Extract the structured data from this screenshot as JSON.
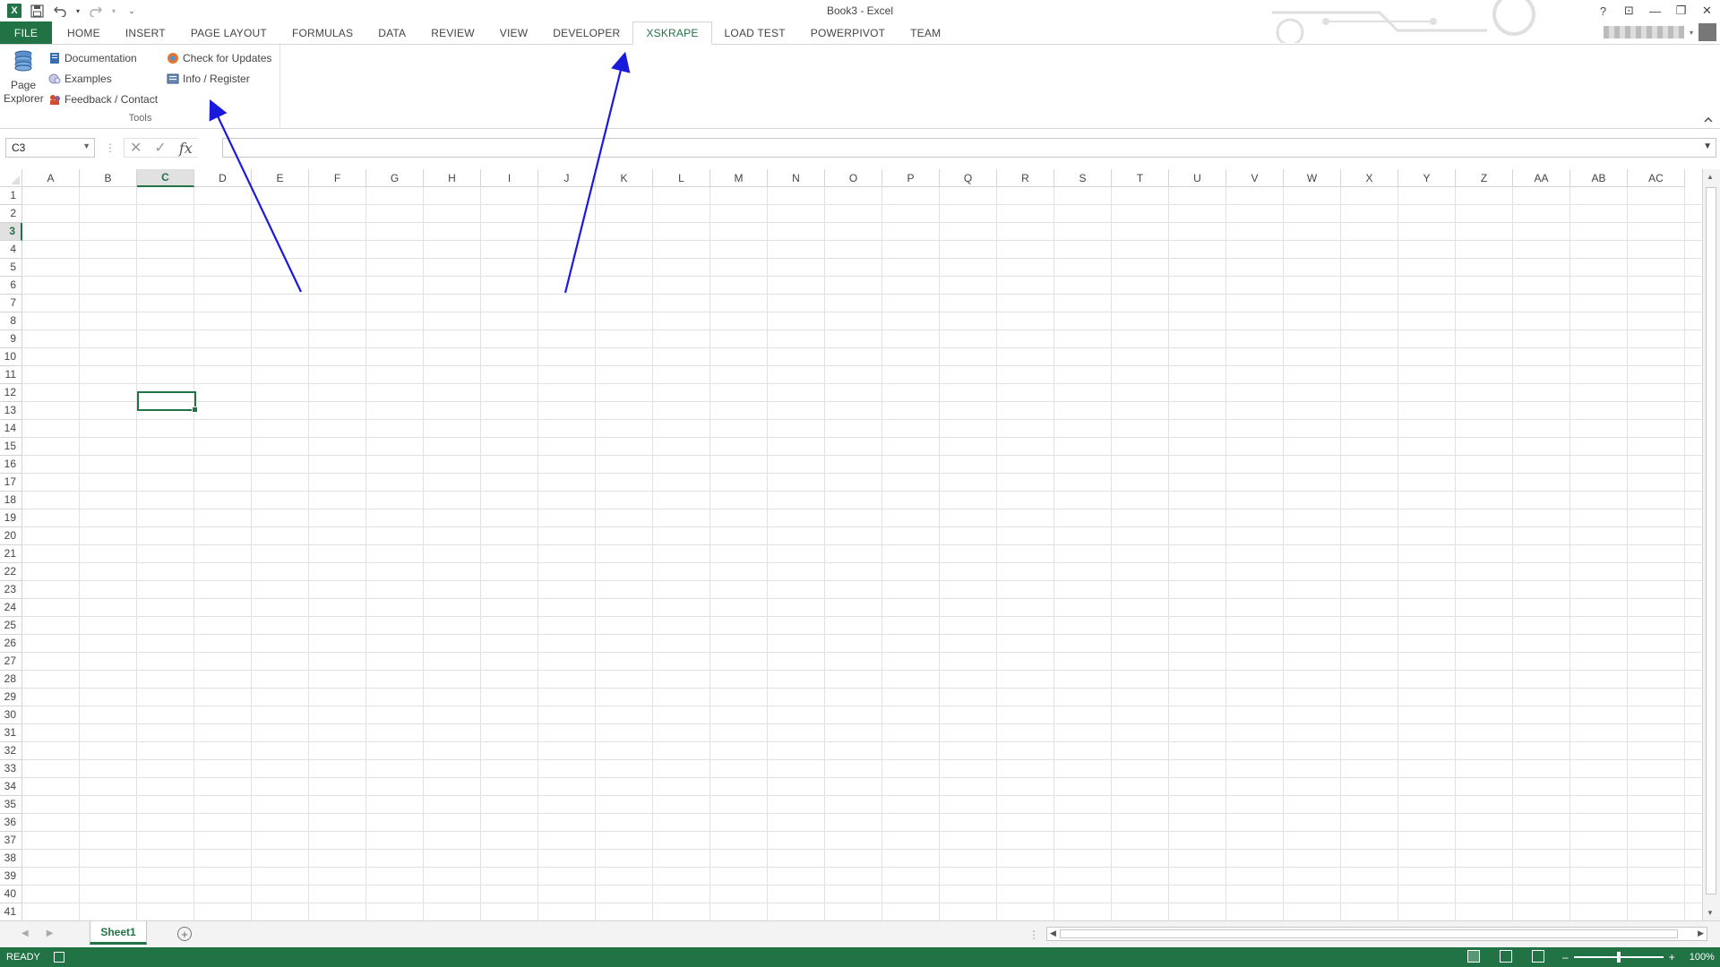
{
  "window": {
    "title": "Book3 - Excel",
    "help": "?",
    "ribbon_display": "⊡",
    "minimize": "—",
    "restore": "❐",
    "close": "✕"
  },
  "qat": {
    "logo": "X",
    "save": "💾",
    "undo": "↶",
    "redo": "↷",
    "customize": "⌄"
  },
  "tabs": [
    {
      "label": "FILE"
    },
    {
      "label": "HOME"
    },
    {
      "label": "INSERT"
    },
    {
      "label": "PAGE LAYOUT"
    },
    {
      "label": "FORMULAS"
    },
    {
      "label": "DATA"
    },
    {
      "label": "REVIEW"
    },
    {
      "label": "VIEW"
    },
    {
      "label": "DEVELOPER"
    },
    {
      "label": "XSKRAPE"
    },
    {
      "label": "LOAD TEST"
    },
    {
      "label": "POWERPIVOT"
    },
    {
      "label": "TEAM"
    }
  ],
  "active_tab": "XSKRAPE",
  "ribbon": {
    "page_explorer_line1": "Page",
    "page_explorer_line2": "Explorer",
    "documentation": "Documentation",
    "examples": "Examples",
    "feedback": "Feedback / Contact",
    "check_updates": "Check for Updates",
    "info_register": "Info / Register",
    "group_label": "Tools",
    "collapse": "^"
  },
  "formula_bar": {
    "name_box": "C3",
    "cancel": "✕",
    "enter": "✓",
    "fx": "fx",
    "value": ""
  },
  "columns": [
    "A",
    "B",
    "C",
    "D",
    "E",
    "F",
    "G",
    "H",
    "I",
    "J",
    "K",
    "L",
    "M",
    "N",
    "O",
    "P",
    "Q",
    "R",
    "S",
    "T",
    "U",
    "V",
    "W",
    "X",
    "Y",
    "Z",
    "AA",
    "AB",
    "AC"
  ],
  "rows": [
    "1",
    "2",
    "3",
    "4",
    "5",
    "6",
    "7",
    "8",
    "9",
    "10",
    "11",
    "12",
    "13",
    "14",
    "15",
    "16",
    "17",
    "18",
    "19",
    "20",
    "21",
    "22",
    "23",
    "24",
    "25",
    "26",
    "27",
    "28",
    "29",
    "30",
    "31",
    "32",
    "33",
    "34",
    "35",
    "36",
    "37",
    "38",
    "39",
    "40",
    "41"
  ],
  "selected_cell": {
    "column": "C",
    "row": "3"
  },
  "sheet_tabs": [
    {
      "label": "Sheet1"
    }
  ],
  "add_sheet": "+",
  "status": {
    "ready": "READY",
    "zoom": "100%",
    "zoom_minus": "–",
    "zoom_plus": "+"
  },
  "colors": {
    "excel_green": "#217346",
    "arrow_blue": "#1a1adc"
  }
}
